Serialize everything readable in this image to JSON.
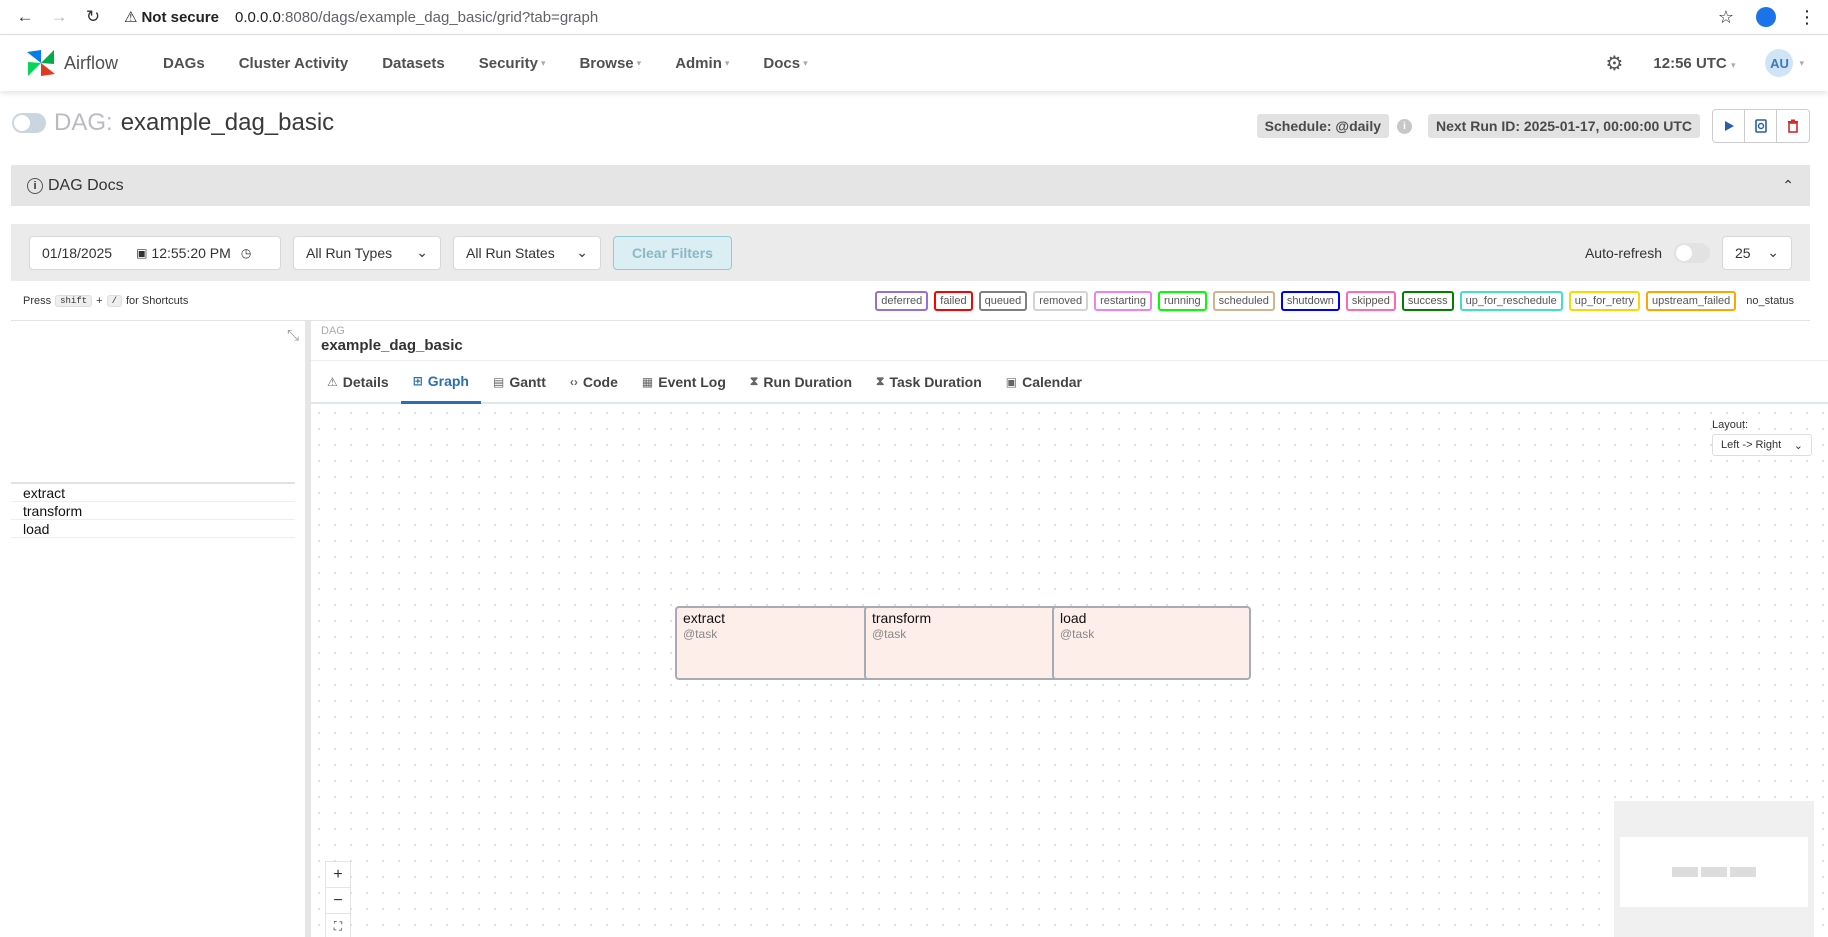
{
  "browser": {
    "security": "Not secure",
    "url_host": "0.0.0.0",
    "url_path": ":8080/dags/example_dag_basic/grid?tab=graph"
  },
  "nav": {
    "logo": "Airflow",
    "items": [
      {
        "label": "DAGs",
        "caret": false
      },
      {
        "label": "Cluster Activity",
        "caret": false
      },
      {
        "label": "Datasets",
        "caret": false
      },
      {
        "label": "Security",
        "caret": true
      },
      {
        "label": "Browse",
        "caret": true
      },
      {
        "label": "Admin",
        "caret": true
      },
      {
        "label": "Docs",
        "caret": true
      }
    ],
    "time": "12:56 UTC",
    "avatar": "AU"
  },
  "dag": {
    "label": "DAG:",
    "name": "example_dag_basic",
    "schedule": "Schedule: @daily",
    "next_run": "Next Run ID: 2025-01-17, 00:00:00 UTC"
  },
  "docs": {
    "title": "DAG Docs"
  },
  "filters": {
    "date": "01/18/2025",
    "time": "12:55:20 PM",
    "run_types": "All Run Types",
    "run_states": "All Run States",
    "clear": "Clear Filters",
    "auto_refresh": "Auto-refresh",
    "page_size": "25"
  },
  "shortcuts": {
    "press": "Press",
    "key1": "shift",
    "plus": "+",
    "key2": "/",
    "suffix": "for Shortcuts"
  },
  "legend": [
    {
      "label": "deferred",
      "color": "#9370db"
    },
    {
      "label": "failed",
      "color": "#ff0000"
    },
    {
      "label": "queued",
      "color": "#808080"
    },
    {
      "label": "removed",
      "color": "#d3d3d3"
    },
    {
      "label": "restarting",
      "color": "#ee82ee"
    },
    {
      "label": "running",
      "color": "#00ff00"
    },
    {
      "label": "scheduled",
      "color": "#d2b48c"
    },
    {
      "label": "shutdown",
      "color": "#0000ff"
    },
    {
      "label": "skipped",
      "color": "#ff69b4"
    },
    {
      "label": "success",
      "color": "#008000"
    },
    {
      "label": "up_for_reschedule",
      "color": "#40e0d0"
    },
    {
      "label": "up_for_retry",
      "color": "#ffd700"
    },
    {
      "label": "upstream_failed",
      "color": "#ffa500"
    },
    {
      "label": "no_status",
      "color": "#ffffff"
    }
  ],
  "tasks": [
    "extract",
    "transform",
    "load"
  ],
  "crumb": {
    "label": "DAG",
    "name": "example_dag_basic"
  },
  "tabs": [
    {
      "label": "Details",
      "icon": "warning-triangle-icon",
      "glyph": "⚠",
      "active": false
    },
    {
      "label": "Graph",
      "icon": "graph-icon",
      "glyph": "⊞",
      "active": true
    },
    {
      "label": "Gantt",
      "icon": "gantt-icon",
      "glyph": "▤",
      "active": false
    },
    {
      "label": "Code",
      "icon": "code-icon",
      "glyph": "‹›",
      "active": false
    },
    {
      "label": "Event Log",
      "icon": "event-log-icon",
      "glyph": "▦",
      "active": false
    },
    {
      "label": "Run Duration",
      "icon": "hourglass-icon",
      "glyph": "⧗",
      "active": false
    },
    {
      "label": "Task Duration",
      "icon": "hourglass-icon",
      "glyph": "⧗",
      "active": false
    },
    {
      "label": "Calendar",
      "icon": "calendar-icon",
      "glyph": "▣",
      "active": false
    }
  ],
  "graph": {
    "layout_label": "Layout:",
    "layout_value": "Left -> Right",
    "nodes": [
      {
        "name": "extract",
        "type": "@task"
      },
      {
        "name": "transform",
        "type": "@task"
      },
      {
        "name": "load",
        "type": "@task"
      }
    ]
  }
}
